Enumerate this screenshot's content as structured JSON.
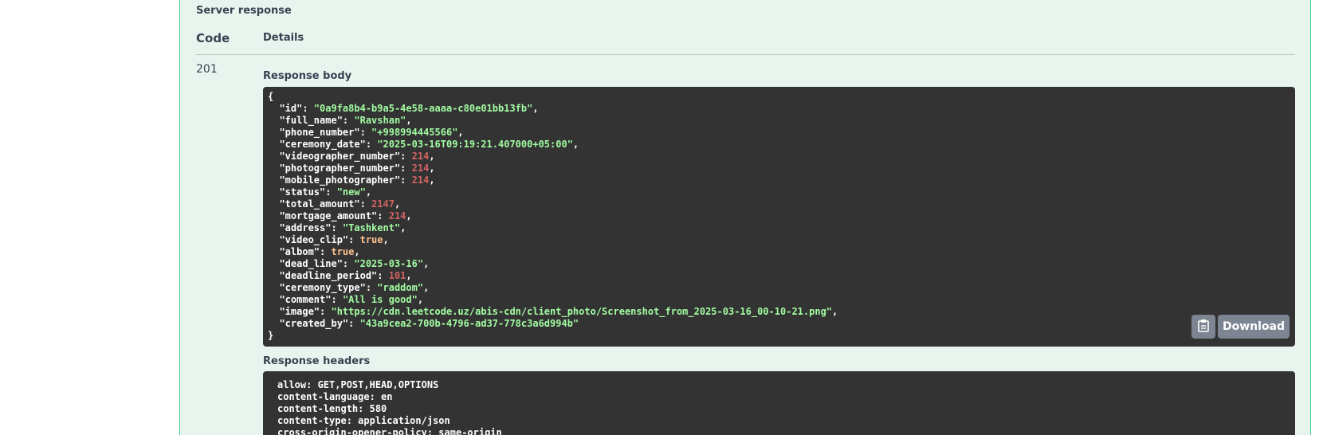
{
  "server_response": {
    "title": "Server response",
    "columns": {
      "code": "Code",
      "details": "Details"
    },
    "status_code": "201",
    "body_label": "Response body",
    "headers_label": "Response headers",
    "download_label": "Download",
    "copy_icon": "clipboard-icon",
    "body": [
      {
        "key": "id",
        "value": "0a9fa8b4-b9a5-4e58-aaaa-c80e01bb13fb",
        "type": "string"
      },
      {
        "key": "full_name",
        "value": "Ravshan",
        "type": "string"
      },
      {
        "key": "phone_number",
        "value": "+998994445566",
        "type": "string"
      },
      {
        "key": "ceremony_date",
        "value": "2025-03-16T09:19:21.407000+05:00",
        "type": "string"
      },
      {
        "key": "videographer_number",
        "value": "214",
        "type": "number"
      },
      {
        "key": "photographer_number",
        "value": "214",
        "type": "number"
      },
      {
        "key": "mobile_photographer",
        "value": "214",
        "type": "number"
      },
      {
        "key": "status",
        "value": "new",
        "type": "string"
      },
      {
        "key": "total_amount",
        "value": "2147",
        "type": "number"
      },
      {
        "key": "mortgage_amount",
        "value": "214",
        "type": "number"
      },
      {
        "key": "address",
        "value": "Tashkent",
        "type": "string"
      },
      {
        "key": "video_clip",
        "value": "true",
        "type": "boolean"
      },
      {
        "key": "albom",
        "value": "true",
        "type": "boolean"
      },
      {
        "key": "dead_line",
        "value": "2025-03-16",
        "type": "string"
      },
      {
        "key": "deadline_period",
        "value": "101",
        "type": "number"
      },
      {
        "key": "ceremony_type",
        "value": "raddom",
        "type": "string"
      },
      {
        "key": "comment",
        "value": "All is good",
        "type": "string"
      },
      {
        "key": "image",
        "value": "https://cdn.leetcode.uz/abis-cdn/client_photo/Screenshot_from_2025-03-16_00-10-21.png",
        "type": "string"
      },
      {
        "key": "created_by",
        "value": "43a9cea2-700b-4796-ad37-778c3a6d994b",
        "type": "string"
      }
    ],
    "headers": [
      "allow: GET,POST,HEAD,OPTIONS",
      "content-language: en",
      "content-length: 580",
      "content-type: application/json",
      "cross-origin-opener-policy: same-origin"
    ]
  },
  "colors": {
    "panel_bg": "#e8f5ef",
    "panel_border": "#49cc90",
    "code_bg": "#333333",
    "json_string": "#a2fca2",
    "json_number": "#d36363",
    "json_boolean": "#fcc28c",
    "button_bg": "#7d8492"
  }
}
